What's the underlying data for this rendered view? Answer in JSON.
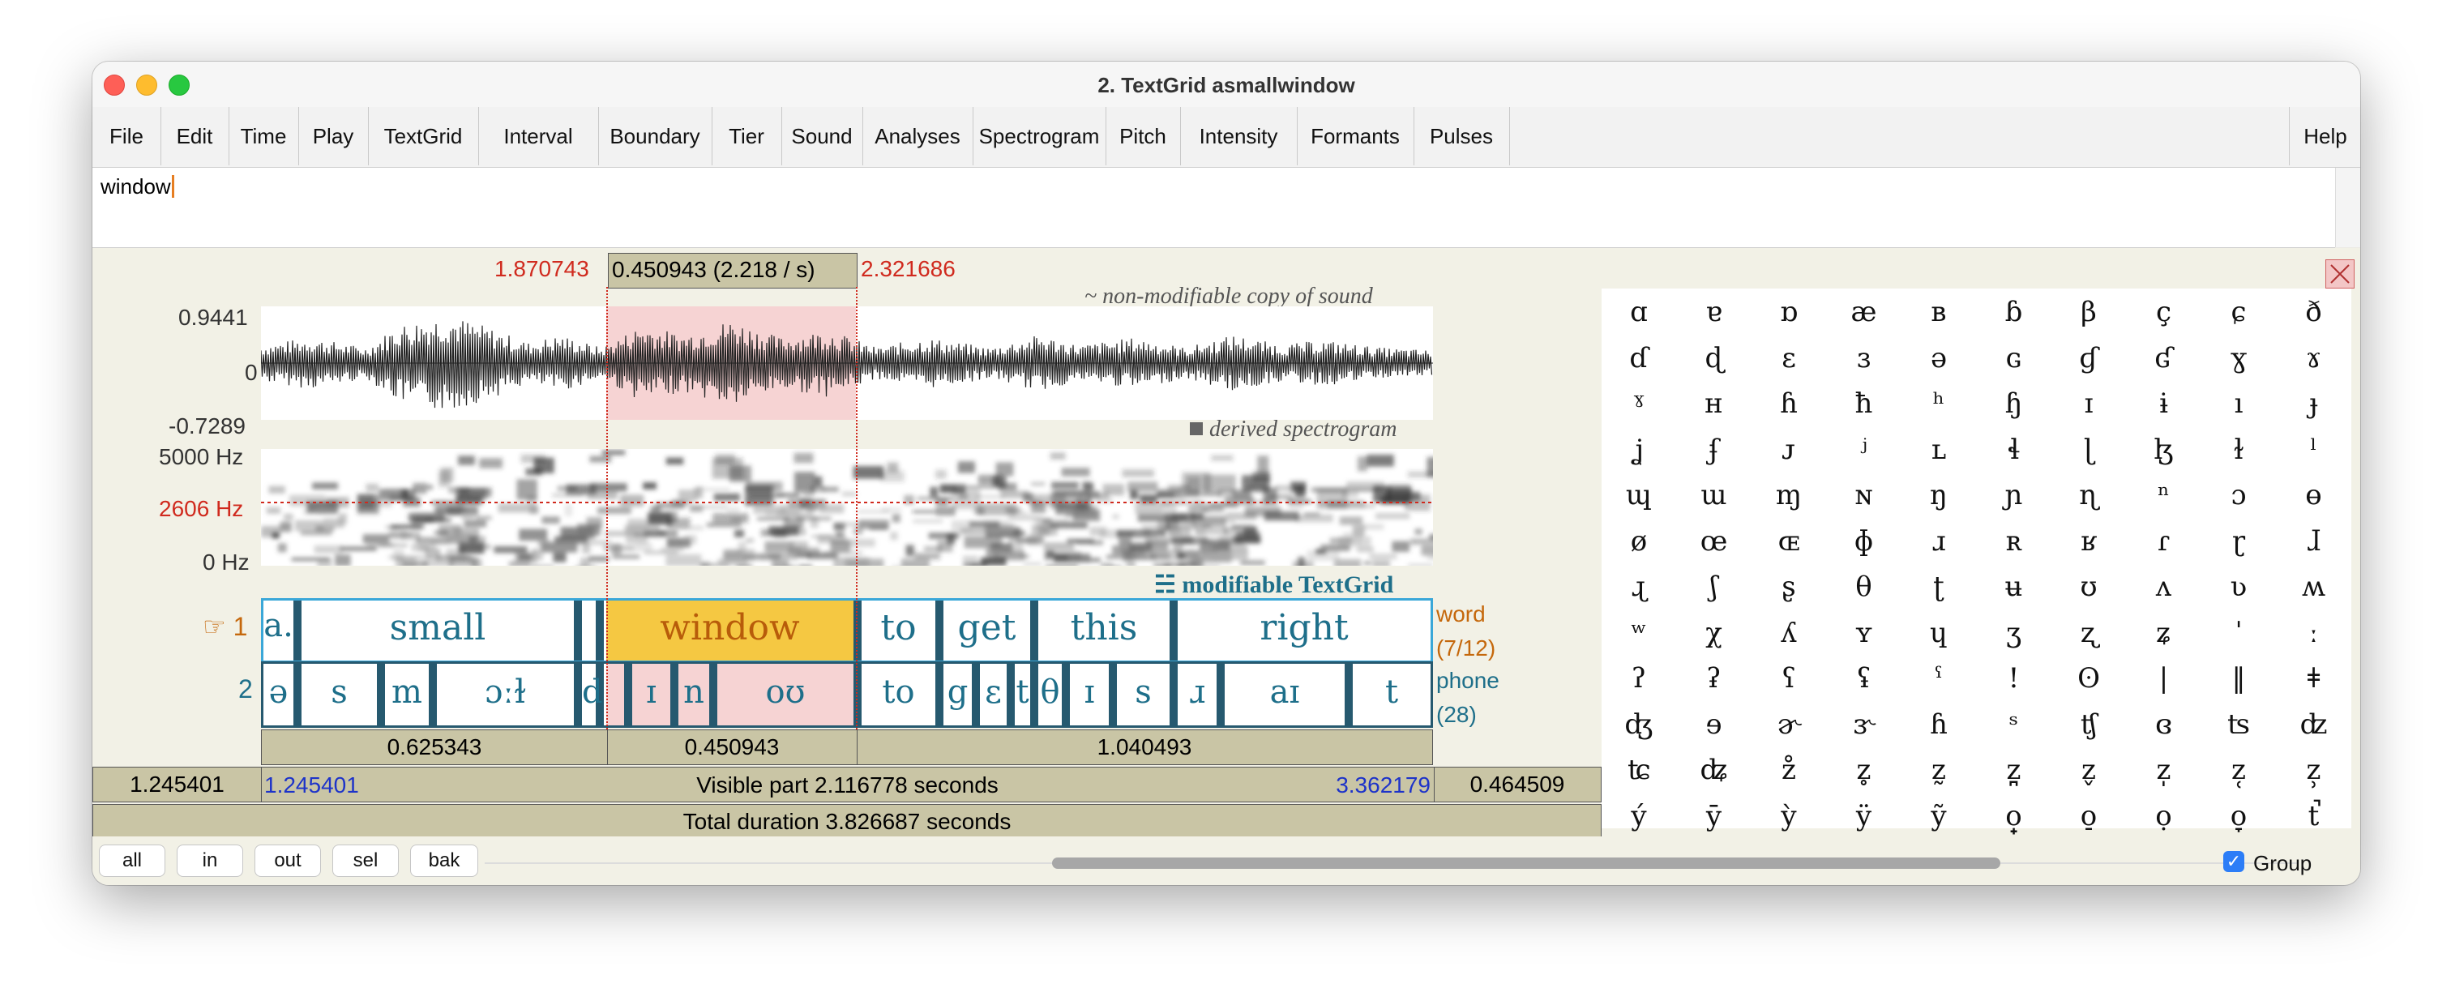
{
  "window": {
    "title": "2. TextGrid asmallwindow"
  },
  "menu": [
    "File",
    "Edit",
    "Time",
    "Play",
    "TextGrid",
    "Interval",
    "Boundary",
    "Tier",
    "Sound",
    "Analyses",
    "Spectrogram",
    "Pitch",
    "Intensity",
    "Formants",
    "Pulses"
  ],
  "help": "Help",
  "text_field": {
    "value": "window"
  },
  "selection": {
    "start": "1.870743",
    "duration": "0.450943 (2.218 / s)",
    "end": "2.321686"
  },
  "sound": {
    "label": "non-modifiable copy of sound",
    "max": "0.9441",
    "zero": "0",
    "min": "-0.7289"
  },
  "spectrogram": {
    "label": "derived spectrogram",
    "top": "5000 Hz",
    "cursor": "2606 Hz",
    "bottom": "0 Hz"
  },
  "textgrid_label": "modifiable TextGrid",
  "tiers": {
    "word": {
      "number": "1",
      "name": "word",
      "count": "(7/12)",
      "intervals": [
        "a.",
        "small",
        "window",
        "to",
        "get",
        "this",
        "right"
      ]
    },
    "phone": {
      "number": "2",
      "name": "phone",
      "count": "(28)",
      "intervals": [
        "ə",
        "s",
        "m",
        "ɔːɫ",
        "d",
        "ɪ",
        "n",
        "oʊ",
        "to",
        "g",
        "ɛ",
        "t",
        "θ",
        "ɪ",
        "s",
        "ɹ",
        "aɪ",
        "t"
      ]
    }
  },
  "durations": {
    "left": "0.625343",
    "sel": "0.450943",
    "right": "1.040493"
  },
  "visible": {
    "left_outside": "1.245401",
    "start": "1.245401",
    "label": "Visible part 2.116778 seconds",
    "end": "3.362179",
    "right_outside": "0.464509"
  },
  "total": "Total duration 3.826687 seconds",
  "buttons": [
    "all",
    "in",
    "out",
    "sel",
    "bak"
  ],
  "group": "Group",
  "ipa_rows": [
    [
      "ɑ",
      "ɐ",
      "ɒ",
      "æ",
      "ʙ",
      "ɓ",
      "β",
      "ç",
      "ɕ",
      "ð"
    ],
    [
      "ɗ",
      "ɖ",
      "ɛ",
      "ɜ",
      "ə",
      "ɢ",
      "ɠ",
      "ʛ",
      "ɣ",
      "ɤ"
    ],
    [
      "ˠ",
      "ʜ",
      "ɦ",
      "ħ",
      "ʰ",
      "ɧ",
      "ɪ",
      "ɨ",
      "ı",
      "ɟ"
    ],
    [
      "ʝ",
      "ʄ",
      "ᴊ",
      "ʲ",
      "ʟ",
      "ɬ",
      "ɭ",
      "ɮ",
      "ɫ",
      "ˡ"
    ],
    [
      "ɰ",
      "ɯ",
      "ɱ",
      "ɴ",
      "ŋ",
      "ɲ",
      "ɳ",
      "ⁿ",
      "ɔ",
      "ɵ"
    ],
    [
      "ø",
      "œ",
      "ɶ",
      "ɸ",
      "ɹ",
      "ʀ",
      "ʁ",
      "ɾ",
      "ɽ",
      "ɺ"
    ],
    [
      "ɻ",
      "ʃ",
      "ʂ",
      "θ",
      "ʈ",
      "ʉ",
      "ʊ",
      "ʌ",
      "ʋ",
      "ʍ"
    ],
    [
      "ʷ",
      "χ",
      "ʎ",
      "ʏ",
      "ɥ",
      "ʒ",
      "ʐ",
      "ʑ",
      "ˈ",
      "ː"
    ],
    [
      "ʔ",
      "ʡ",
      "ʕ",
      "ʢ",
      "ˤ",
      "!",
      "ʘ",
      "|",
      "‖",
      "ǂ"
    ],
    [
      "ʤ",
      "ɘ",
      "ɚ",
      "ɝ",
      "ɦ",
      "ˢ",
      "ʧ",
      "ɞ",
      "ʦ",
      "ʣ"
    ],
    [
      "ʨ",
      "ʥ",
      "z̊",
      "z̥",
      "z̰",
      "z̪",
      "z̬",
      "z̩",
      "z̜",
      "z̹"
    ],
    [
      "ý",
      "ȳ",
      "ỳ",
      "ÿ",
      "ỹ",
      "o̟",
      "o̠",
      "ọ",
      "o̞",
      "t̚"
    ]
  ]
}
